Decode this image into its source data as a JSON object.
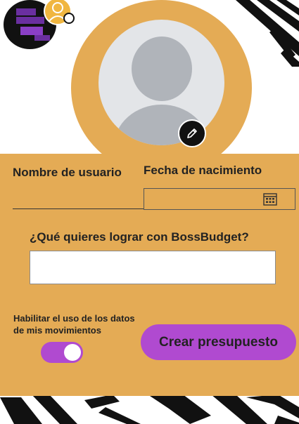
{
  "profile": {
    "username_label": "Nombre de usuario",
    "username_value": "",
    "birthdate_label": "Fecha de nacimiento",
    "birthdate_value": "",
    "goal_label": "¿Qué quieres lograr con BossBudget?",
    "goal_value": "",
    "data_toggle_label": "Habilitar el uso de los datos de mis movimientos",
    "data_toggle_on": true,
    "create_button_label": "Crear presupuesto"
  },
  "icons": {
    "logo": "bossbudget-logo",
    "user_settings": "user-settings-icon",
    "avatar": "default-avatar-icon",
    "edit": "pencil-icon",
    "calendar": "calendar-icon"
  },
  "colors": {
    "panel": "#e4ab55",
    "accent": "#b04ad0",
    "toggle_knob": "#ffffff",
    "logo_bg": "#111111",
    "logo_accent": "#6a2fa0"
  }
}
